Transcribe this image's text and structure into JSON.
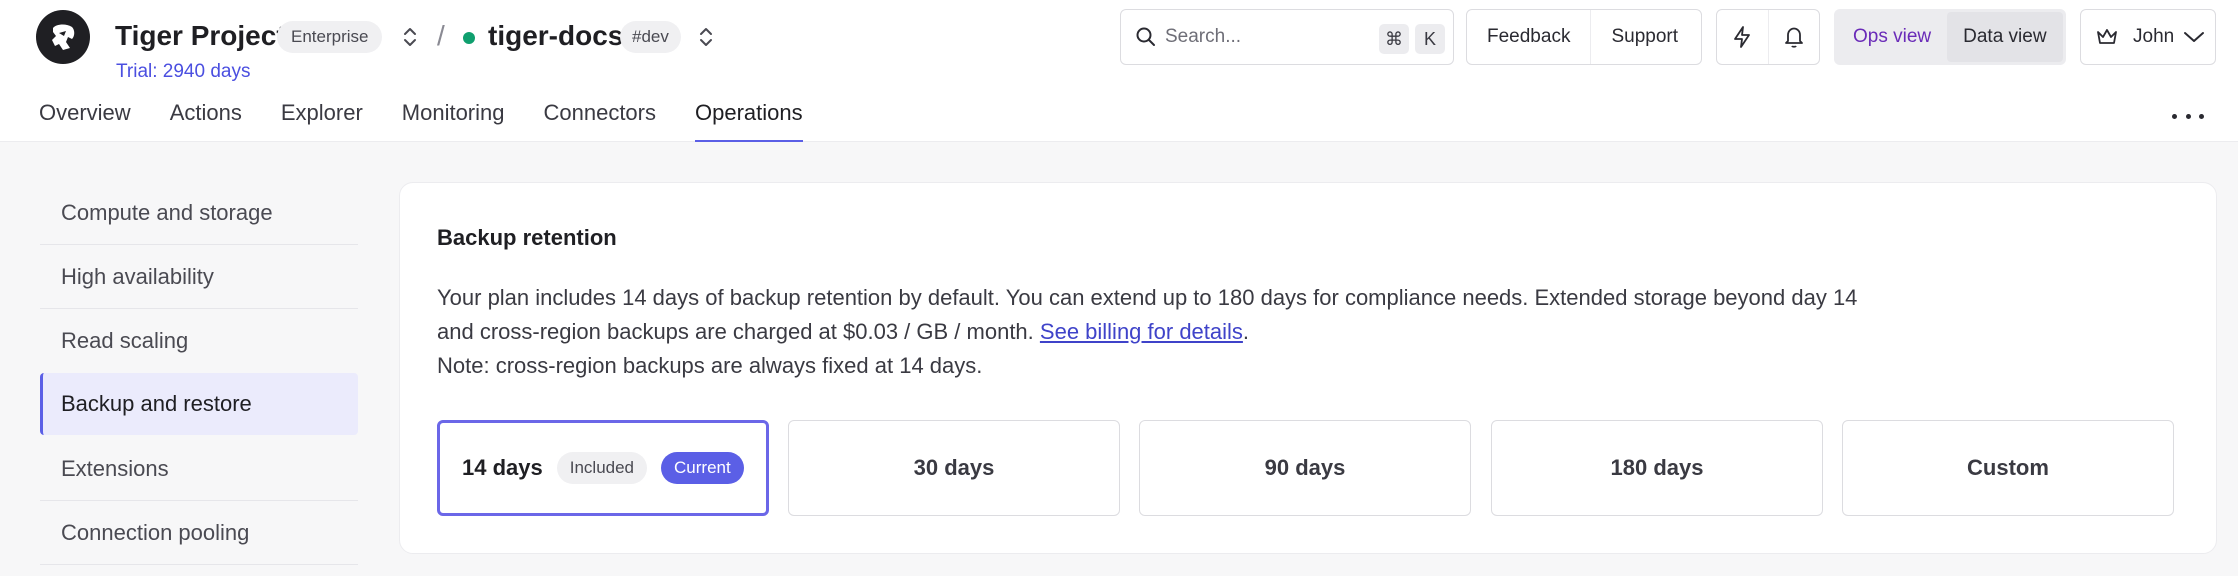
{
  "header": {
    "project_name": "Tiger Project",
    "plan_badge": "Enterprise",
    "separator": "/",
    "service_name": "tiger-docs",
    "service_status_color": "#0f9f6e",
    "env_badge": "#dev",
    "trial_text": "Trial: 2940 days",
    "search": {
      "placeholder": "Search...",
      "shortcut_keys": [
        "⌘",
        "K"
      ]
    },
    "feedback_label": "Feedback",
    "support_label": "Support",
    "view_toggle": {
      "ops_label": "Ops view",
      "data_label": "Data view",
      "selected": "Ops view"
    },
    "user_name": "John"
  },
  "tabs": [
    {
      "label": "Overview"
    },
    {
      "label": "Actions"
    },
    {
      "label": "Explorer"
    },
    {
      "label": "Monitoring"
    },
    {
      "label": "Connectors"
    },
    {
      "label": "Operations",
      "active": true
    }
  ],
  "sidebar": {
    "items": [
      {
        "label": "Compute and storage"
      },
      {
        "label": "High availability"
      },
      {
        "label": "Read scaling"
      },
      {
        "label": "Backup and restore",
        "active": true
      },
      {
        "label": "Extensions"
      },
      {
        "label": "Connection pooling"
      }
    ]
  },
  "backup": {
    "title": "Backup retention",
    "desc_part1": "Your plan includes 14 days of backup retention by default. You can extend up to 180 days for compliance needs. Extended storage beyond day 14 and cross-region backups are charged at $0.03 / GB / month. ",
    "billing_link": "See billing for details",
    "desc_period": ".",
    "note": "Note: cross-region backups are always fixed at 14 days.",
    "options": [
      {
        "label": "14 days",
        "included_badge": "Included",
        "current_badge": "Current",
        "selected": true
      },
      {
        "label": "30 days"
      },
      {
        "label": "90 days"
      },
      {
        "label": "180 days"
      },
      {
        "label": "Custom"
      }
    ]
  },
  "colors": {
    "accent": "#5b5fe6",
    "link": "#3f43c9",
    "ops_view_text": "#6a2bb8"
  }
}
